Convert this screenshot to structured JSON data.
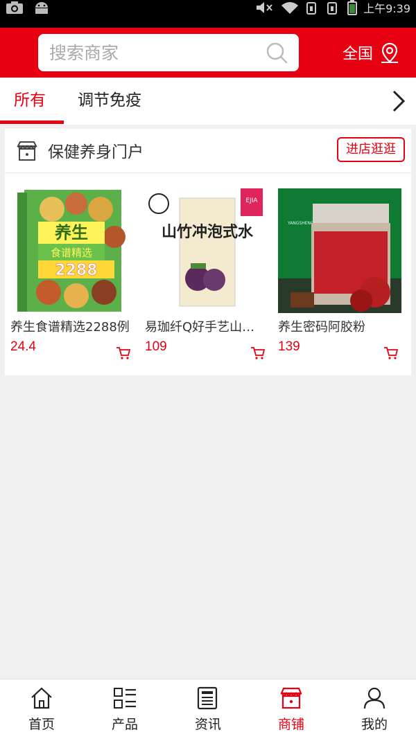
{
  "status_bar": {
    "time": "上午9:39"
  },
  "header": {
    "search_placeholder": "搜索商家",
    "region_label": "全国"
  },
  "tabs": [
    {
      "label": "所有"
    },
    {
      "label": "调节免疫"
    }
  ],
  "shop": {
    "name": "保健养身门户",
    "visit_label": "进店逛逛",
    "products": [
      {
        "name": "养生食谱精选2288例",
        "price": "24.4"
      },
      {
        "name": "易珈纤Q好手艺山竹水",
        "price": "109"
      },
      {
        "name": "养生密码阿胶粉",
        "price": "139"
      }
    ]
  },
  "bottom_nav": [
    {
      "label": "首页"
    },
    {
      "label": "产品"
    },
    {
      "label": "资讯"
    },
    {
      "label": "商铺"
    },
    {
      "label": "我的"
    }
  ],
  "colors": {
    "accent": "#e60012",
    "background": "#f0f0f0"
  },
  "images": {
    "book_title": "养生",
    "book_subtitle": "食谱精选",
    "book_number": "2288",
    "drink_text": "山竹冲泡式水",
    "brand_tag": "EJIA",
    "jar_brand": "YANGSHENGMIMA 养生密码"
  }
}
